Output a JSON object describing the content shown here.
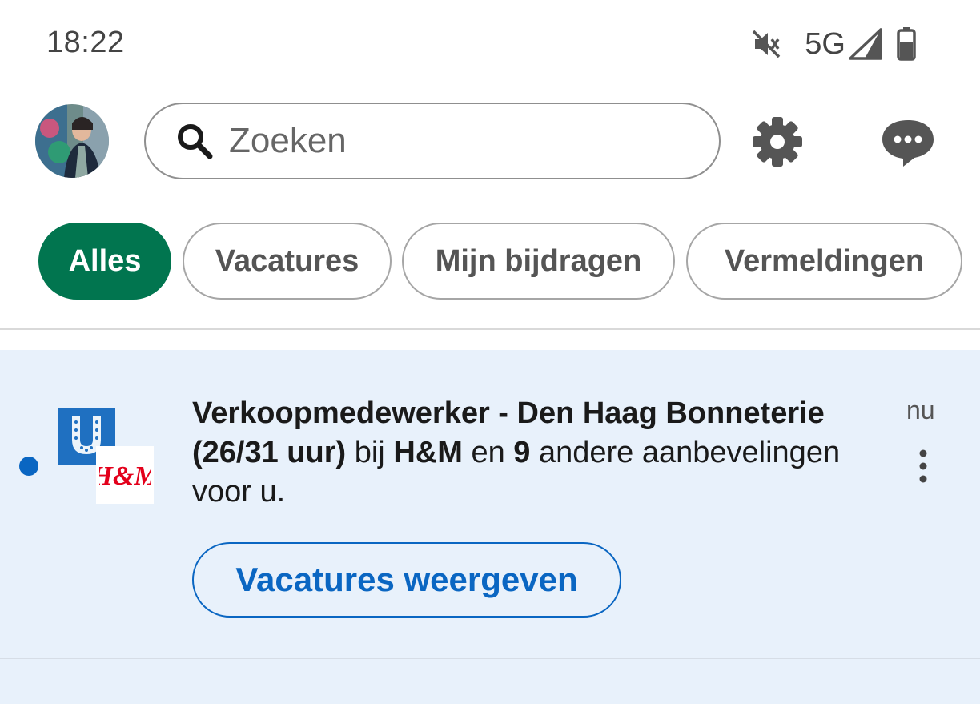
{
  "status_bar": {
    "time": "18:22",
    "network": "5G",
    "icons": [
      "mute-icon",
      "signal-icon",
      "battery-icon"
    ]
  },
  "header": {
    "avatar": "profile-avatar",
    "search_placeholder": "Zoeken",
    "icons": [
      "search-icon",
      "gear-icon",
      "messages-icon"
    ]
  },
  "filters": {
    "items": [
      {
        "label": "Alles",
        "active": true
      },
      {
        "label": "Vacatures",
        "active": false
      },
      {
        "label": "Mijn bijdragen",
        "active": false
      },
      {
        "label": "Vermeldingen",
        "active": false
      }
    ]
  },
  "notification": {
    "unread": true,
    "logos": [
      "Unilever",
      "H&M"
    ],
    "title_bold": "Verkoopmedewerker - Den Haag Bonneterie (26/31 uur)",
    "text_bij": "bij",
    "company": "H&M",
    "text_en": "en",
    "count": "9",
    "text_rest": "andere aanbevelingen voor u.",
    "time": "nu",
    "button_label": "Vacatures weergeven"
  },
  "colors": {
    "accent_green": "#01754f",
    "link_blue": "#0a66c2",
    "card_background": "#e8f1fb"
  }
}
